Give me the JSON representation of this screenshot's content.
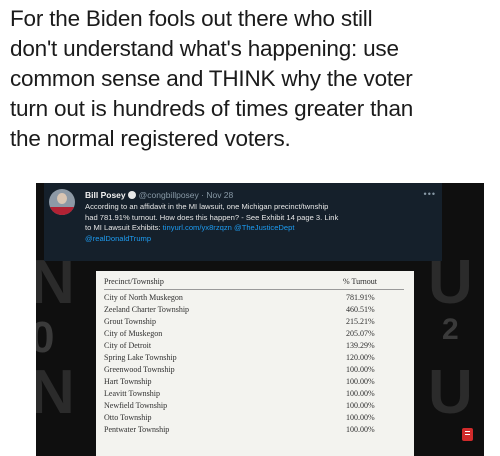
{
  "caption": {
    "lines": [
      "For the Biden fools out there who still",
      "don't understand what's happening: use",
      "common sense and THINK why the voter",
      "turn out is hundreds of times greater than",
      "the normal registered voters."
    ]
  },
  "tweet": {
    "name": "Bill Posey",
    "handle": "@congbillposey · Nov 28",
    "more": "•••",
    "body_line1": "According to an affidavit in the MI lawsuit, one Michigan precinct/twnship",
    "body_line2": "had 781.91% turnout. How does this happen? - See Exhibit 14 page 3. Link",
    "body_line3_text": "to MI Lawsuit Exhibits:",
    "body_line3_link": "tinyurl.com/yx8rzqzn @TheJusticeDept",
    "body_line4_link": "@realDonaldTrump"
  },
  "table": {
    "headers": [
      "Precinct/Township",
      "% Turnout"
    ],
    "rows": [
      [
        "City of North Muskegon",
        "781.91%"
      ],
      [
        "Zeeland Charter Township",
        "460.51%"
      ],
      [
        "Grout Township",
        "215.21%"
      ],
      [
        "City of Muskegon",
        "205.07%"
      ],
      [
        "City of Detroit",
        "139.29%"
      ],
      [
        "Spring Lake Township",
        "120.00%"
      ],
      [
        "Greenwood Township",
        "100.00%"
      ],
      [
        "Hart Township",
        "100.00%"
      ],
      [
        "Leavitt Township",
        "100.00%"
      ],
      [
        "Newfield Township",
        "100.00%"
      ],
      [
        "Otto Township",
        "100.00%"
      ],
      [
        "Pentwater Township",
        "100.00%"
      ]
    ]
  },
  "background": {
    "left_text": "N",
    "left_mark": "0",
    "right_text": "U",
    "right_mark": "2"
  },
  "colors": {
    "card_bg": "#0f0f0f",
    "tweet_bg": "#15202b",
    "link": "#1d9bf0",
    "doc_bg": "#f3f3ef"
  }
}
